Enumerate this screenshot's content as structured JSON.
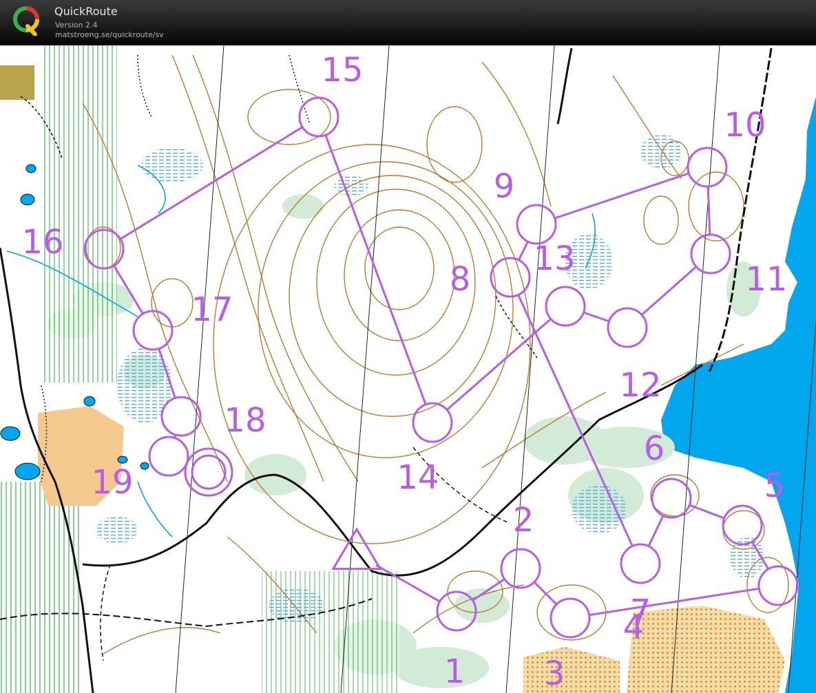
{
  "app": {
    "title": "QuickRoute",
    "version": "Version 2.4",
    "url": "matstroeng.se/quickroute/sv",
    "logo_letter": "Q",
    "logo_icon": "quickroute-q-logo"
  },
  "course": {
    "color": "#b65ee8",
    "start_symbol": "triangle",
    "finish_symbol": "double-circle",
    "controls": [
      {
        "label": "1",
        "number": "1"
      },
      {
        "label": "2",
        "number": "2"
      },
      {
        "label": "3",
        "number": "3"
      },
      {
        "label": "4",
        "number": "4"
      },
      {
        "label": "5",
        "number": "5"
      },
      {
        "label": "6",
        "number": "6"
      },
      {
        "label": "7",
        "number": "7"
      },
      {
        "label": "8",
        "number": "8"
      },
      {
        "label": "9",
        "number": "9"
      },
      {
        "label": "10",
        "number": "10"
      },
      {
        "label": "11",
        "number": "11"
      },
      {
        "label": "12",
        "number": "12"
      },
      {
        "label": "13",
        "number": "13"
      },
      {
        "label": "14",
        "number": "14"
      },
      {
        "label": "15",
        "number": "15"
      },
      {
        "label": "16",
        "number": "16"
      },
      {
        "label": "17",
        "number": "17"
      },
      {
        "label": "18",
        "number": "18"
      },
      {
        "label": "19",
        "number": "19"
      }
    ]
  },
  "map_colors": {
    "open_land": "#ffffff",
    "contour": "#c07a2c",
    "water": "#00a6ee",
    "marsh": "#3fa7e6",
    "green_vegetation": "#d2ebd6",
    "rough_open": "#f5c98d",
    "path": "#111111",
    "magnetic_north_lines": "#222222"
  }
}
